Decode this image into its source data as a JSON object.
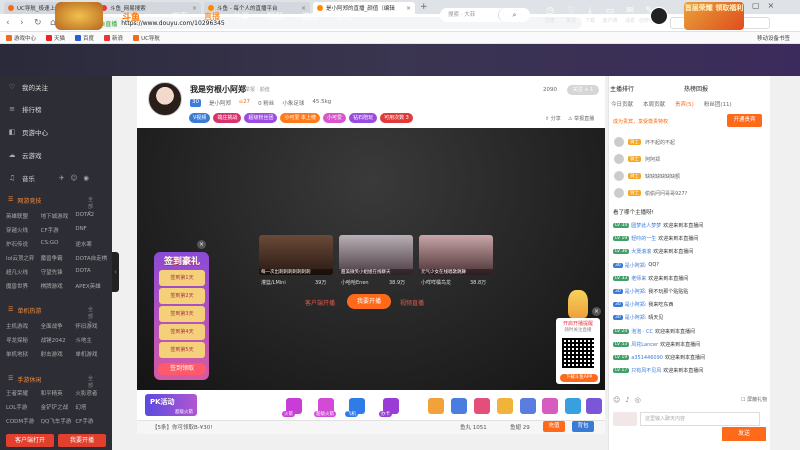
{
  "browser": {
    "tabs": [
      {
        "label": "UC导航_极速上网体验",
        "color": "#f26b1d"
      },
      {
        "label": "斗鱼_网易搜索",
        "color": "#e34"
      },
      {
        "label": "斗鱼 - 每个人的直播平台",
        "color": "#f80"
      },
      {
        "label": "是小阿郑的直播_颜值（编辑",
        "color": "#f80"
      }
    ],
    "url": "https://www.douyu.com/10296345",
    "url_prefix": "斗鱼直播",
    "search_placeholder": "百度",
    "bookmarks": [
      "游戏中心",
      "天猫",
      "百度",
      "新浪",
      "UC导航"
    ],
    "bookmark_right": "移动设备书签"
  },
  "site": {
    "logo_text": "斗鱼",
    "nav": [
      "首页",
      "直播",
      "分类",
      "视频",
      "游戏",
      "鱼吧"
    ],
    "active_nav": "直播",
    "search_placeholder": "搜索 · 大菲",
    "search_icon": "search-icon",
    "top_icons": [
      "历史",
      "关注",
      "下载",
      "客户端",
      "消息",
      "创作中心"
    ],
    "banner": "首届荣耀 领取福利"
  },
  "sidebar": {
    "items": [
      "我的关注",
      "排行榜",
      "页游中心",
      "云游戏"
    ],
    "music_row": "音乐",
    "sec1": {
      "title": "网游竞技",
      "all": "全部 >",
      "games": [
        "英雄联盟",
        "地下城游戏",
        "DOTA2",
        "穿越火线",
        "CF手游",
        "DNF",
        "炉石传说",
        "CS:GO",
        "逆水寒",
        "lol云顶之弈",
        "魔兽争霸",
        "DOTA自走棋",
        "超凡火线",
        "守望先锋",
        "DOTA",
        "魔兽世界",
        "棋牌游戏",
        "APEX英雄"
      ]
    },
    "sec2": {
      "title": "单机热游",
      "all": "全部 >",
      "games": [
        "主机游戏",
        "全面战争",
        "怀旧游戏",
        "寻龙探秘",
        "战锤2042",
        "斗地主",
        "单机地狱",
        "射击游戏",
        "单机游戏"
      ]
    },
    "sec3": {
      "title": "手游休闲",
      "all": "全部 >",
      "games": [
        "王者荣耀",
        "和平精英",
        "火影忍者",
        "LOL手游",
        "金铲铲之战",
        "幻塔",
        "CODM手游",
        "QQ飞车手游",
        "CF手游"
      ]
    },
    "btn_client": "客户端打开",
    "btn_live": "我要开播"
  },
  "room": {
    "title": "我是穷根小阿郑",
    "tag": "举报 · 颜值",
    "level": "30",
    "streamer": "是小阿郑",
    "hot": "27",
    "fans": "0 粉丝",
    "city": "小象足球",
    "heat": "45.5kg",
    "room_num": "2090",
    "follow": "关注 + 1",
    "share": "分享",
    "report": "举报直播",
    "badges": [
      {
        "text": "V视频",
        "color": "#3a7bd5"
      },
      {
        "text": "端庄挑战",
        "color": "#d6336c"
      },
      {
        "text": "超级粉丝团",
        "color": "#9b4be0"
      },
      {
        "text": "小可爱 本上榜",
        "color": "#ff7a1a"
      },
      {
        "text": "小可爱",
        "color": "#d856c9"
      },
      {
        "text": "钻石陪玩",
        "color": "#9b4be0"
      },
      {
        "text": "可用次数 3",
        "color": "#e03b3b"
      }
    ]
  },
  "player": {
    "recommend": [
      {
        "name": "灌篮/LMini",
        "count": "39万",
        "caption": "每一次出刺刺刺刺刺刺刺"
      },
      {
        "name": "小哈哈Enen",
        "count": "38.9万",
        "caption": "甜美微笑小姐姐在线聊天"
      },
      {
        "name": "小咩咩橘鸟龙",
        "count": "38.8万",
        "caption": "元气少女在线唱歌跳舞"
      }
    ],
    "link_left": "客户端开播",
    "start_btn": "我要开播",
    "link_right": "视频直播",
    "signin": {
      "title": "签到豪礼",
      "slots": [
        "签到第1天",
        "签到第2天",
        "签到第3天",
        "签到第4天",
        "签到第5天"
      ],
      "button": "签到领取"
    },
    "qr": {
      "title": "开启开播提醒",
      "sub": "随时关注直播",
      "btn": "下载斗鱼APP"
    }
  },
  "giftbar": {
    "left_label": "PK活动",
    "left_sub": "超级火箭",
    "items": [
      {
        "label": "火箭",
        "color": "#c83cd8"
      },
      {
        "label": "超级火箭",
        "color": "#d24ad6"
      },
      {
        "label": "飞机",
        "color": "#2f7be8"
      },
      {
        "label": "办卡",
        "color": "#9a3cd6"
      },
      {
        "label": "",
        "color": "#f2a23a"
      },
      {
        "label": "",
        "color": "#4a7de0"
      },
      {
        "label": "",
        "color": "#e44f7a"
      },
      {
        "label": "",
        "color": "#f0b43a"
      },
      {
        "label": "",
        "color": "#5c7de0"
      },
      {
        "label": "",
        "color": "#d85cc0"
      },
      {
        "label": "",
        "color": "#39a0e0"
      },
      {
        "label": "",
        "color": "#7b57d8"
      }
    ],
    "notice": "【5条】你可领取B-¥30!",
    "fishball": "鱼丸 1051",
    "yuwan": "鱼翅 29",
    "recharge": "充值",
    "backpack": "背包"
  },
  "chat": {
    "rank_title": "主播排行",
    "rank_right": "热榜回报",
    "tabs": [
      "今日贡献",
      "本周贡献",
      "贵宾(5)",
      "粉丝团(11)"
    ],
    "active_tab": "贵宾(5)",
    "hint": "成为贵宾，享受尊贵特权",
    "rank_btn": "开通贵宾",
    "ranks": [
      {
        "lv": "骑士",
        "msg": "坏不起的不起"
      },
      {
        "lv": "骑士",
        "msg": "阿阿郑"
      },
      {
        "lv": "骑士",
        "msg": "缺缺缺缺缺缺额"
      },
      {
        "lv": "骑士",
        "msg": "偷偷问问哥哥927?"
      }
    ],
    "history": "看了哪个主播呀!",
    "lines": [
      {
        "lv": "LV 34",
        "lvc": "#43a06a",
        "name": "圆梦此人梦梦",
        "msg": "欢迎来到本直播间"
      },
      {
        "lv": "LV 19",
        "lvc": "#43a06a",
        "name": "轻吟的一生",
        "msg": "欢迎来到本直播间"
      },
      {
        "lv": "LV 36",
        "lvc": "#43a06a",
        "name": "大煲滚滚",
        "msg": "欢迎来到本直播间"
      },
      {
        "lv": "30",
        "lvc": "#3a7bd5",
        "name": "是小阿郑:",
        "msg": "QQ?"
      },
      {
        "lv": "LV 33",
        "lvc": "#43a06a",
        "name": "老师来",
        "msg": "欢迎来到本直播间"
      },
      {
        "lv": "30",
        "lvc": "#3a7bd5",
        "name": "是小阿郑:",
        "msg": "我不玩那个贴贴贴"
      },
      {
        "lv": "30",
        "lvc": "#3a7bd5",
        "name": "是小阿郑:",
        "msg": "我来吃东西"
      },
      {
        "lv": "30",
        "lvc": "#3a7bd5",
        "name": "是小阿郑:",
        "msg": "晴天见"
      },
      {
        "lv": "LV 24",
        "lvc": "#43a06a",
        "name": "泡泡 · CC",
        "msg": "欢迎来到本直播间"
      },
      {
        "lv": "LV 53",
        "lvc": "#43a06a",
        "name": "风花Lancer",
        "msg": "欢迎来到本直播间"
      },
      {
        "lv": "LV 19",
        "lvc": "#43a06a",
        "name": "a351446090",
        "msg": "欢迎来到本直播间"
      },
      {
        "lv": "LV 17",
        "lvc": "#43a06a",
        "name": "只有风不见风",
        "msg": "欢迎来到本直播间"
      }
    ],
    "blank_label": "屏蔽礼物",
    "input_placeholder": "这里输入聊天内容",
    "send": "发送"
  }
}
